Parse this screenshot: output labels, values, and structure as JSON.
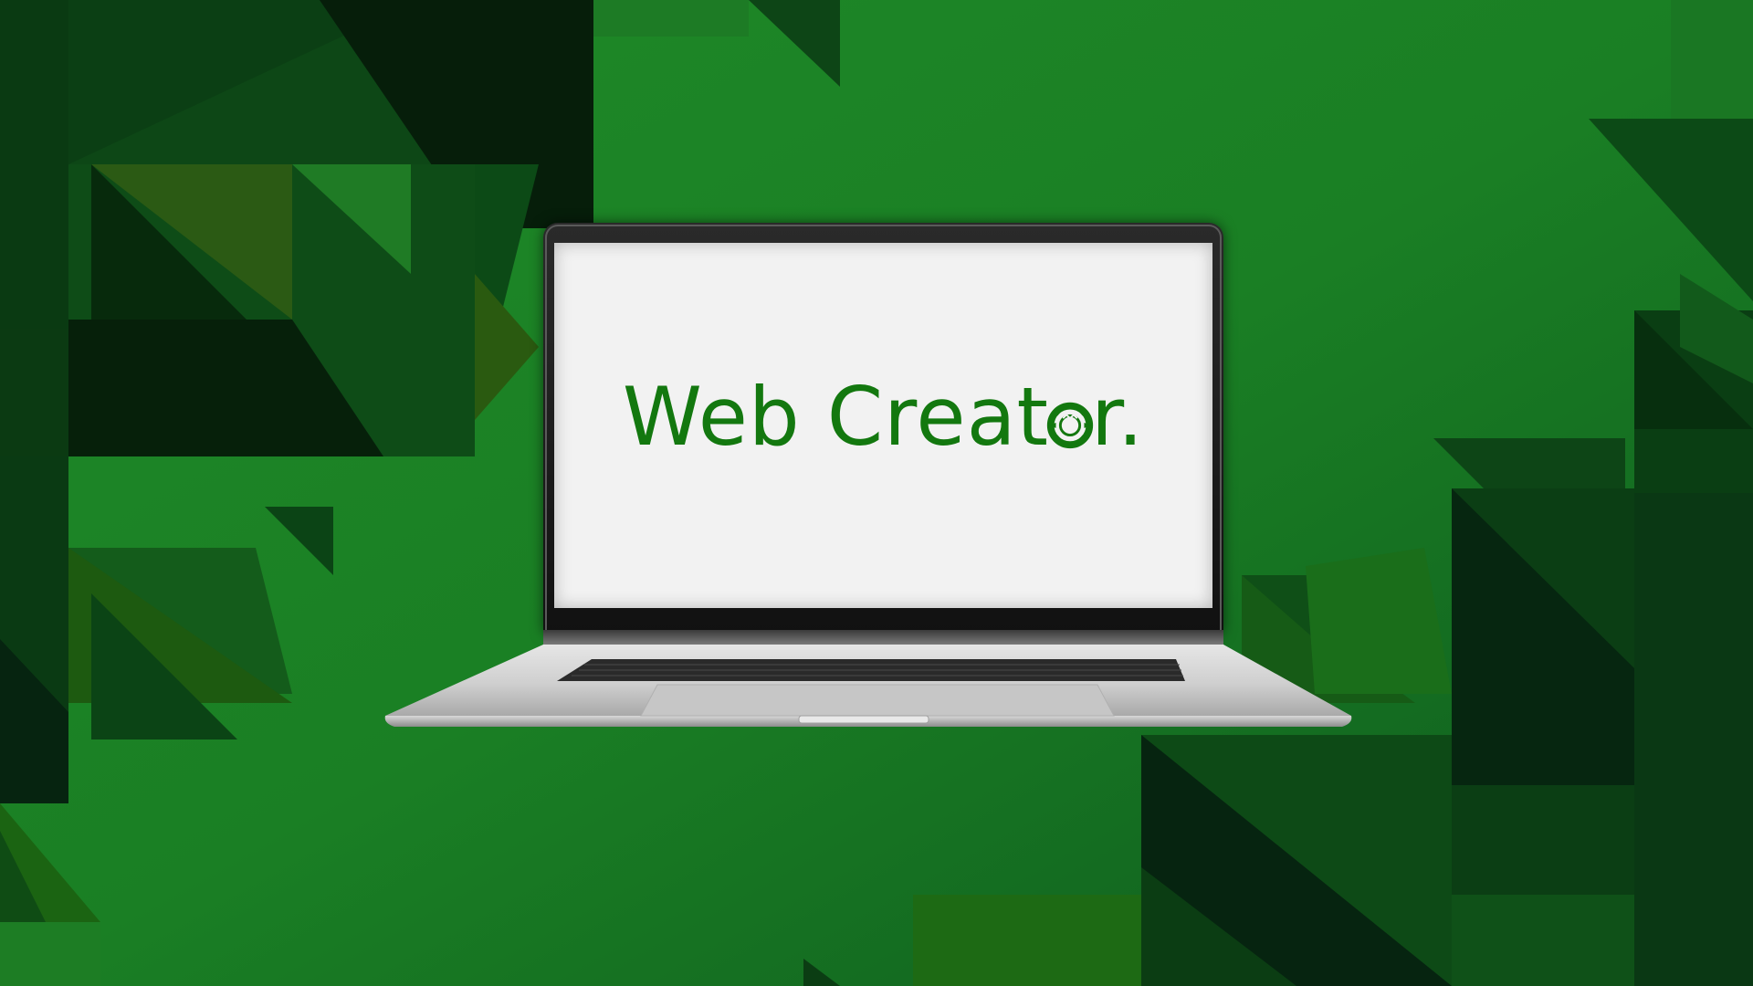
{
  "brand": {
    "logo_text_before": "Web Creat",
    "logo_text_after": "r.",
    "logo_o_icon": "gear-o-icon",
    "color": "#13780f"
  },
  "colors": {
    "background_green": "#1a7a22",
    "screen": "#f2f2f2",
    "laptop_body": "#c8c8c8"
  }
}
